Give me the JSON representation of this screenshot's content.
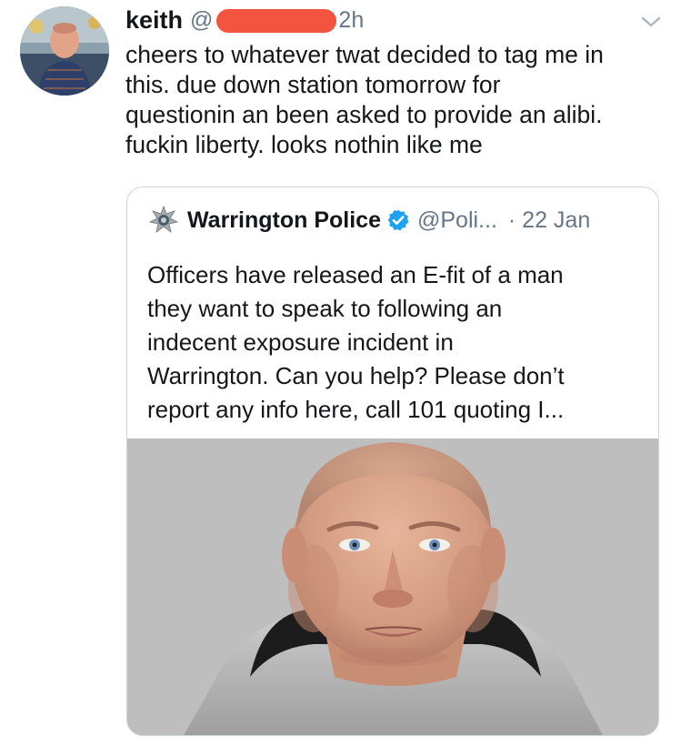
{
  "tweet": {
    "display_name": "keith",
    "handle_prefix": "@",
    "time": "2h",
    "text_lines": [
      "cheers to whatever twat decided to tag me in",
      "this. due down station tomorrow for",
      "questionin an been asked to provide an alibi.",
      "fuckin liberty. looks nothin like me"
    ]
  },
  "quoted_tweet": {
    "display_name": "Warrington Police",
    "handle": "@Poli...",
    "time": "· 22 Jan",
    "text_lines": [
      "Officers have released an E-fit of a man",
      "they want to speak to following an",
      "indecent exposure incident in",
      "Warrington. Can you help? Please don’t",
      "report any info here, call 101 quoting I..."
    ]
  },
  "icons": {
    "caret": "chevron-down-icon",
    "verified": "verified-badge-icon",
    "police_logo": "police-badge-icon"
  },
  "colors": {
    "text_primary": "#14171a",
    "text_secondary": "#657786",
    "border": "#ccd6dd",
    "verified_blue": "#1da1f2",
    "redaction": "#f2543f"
  }
}
